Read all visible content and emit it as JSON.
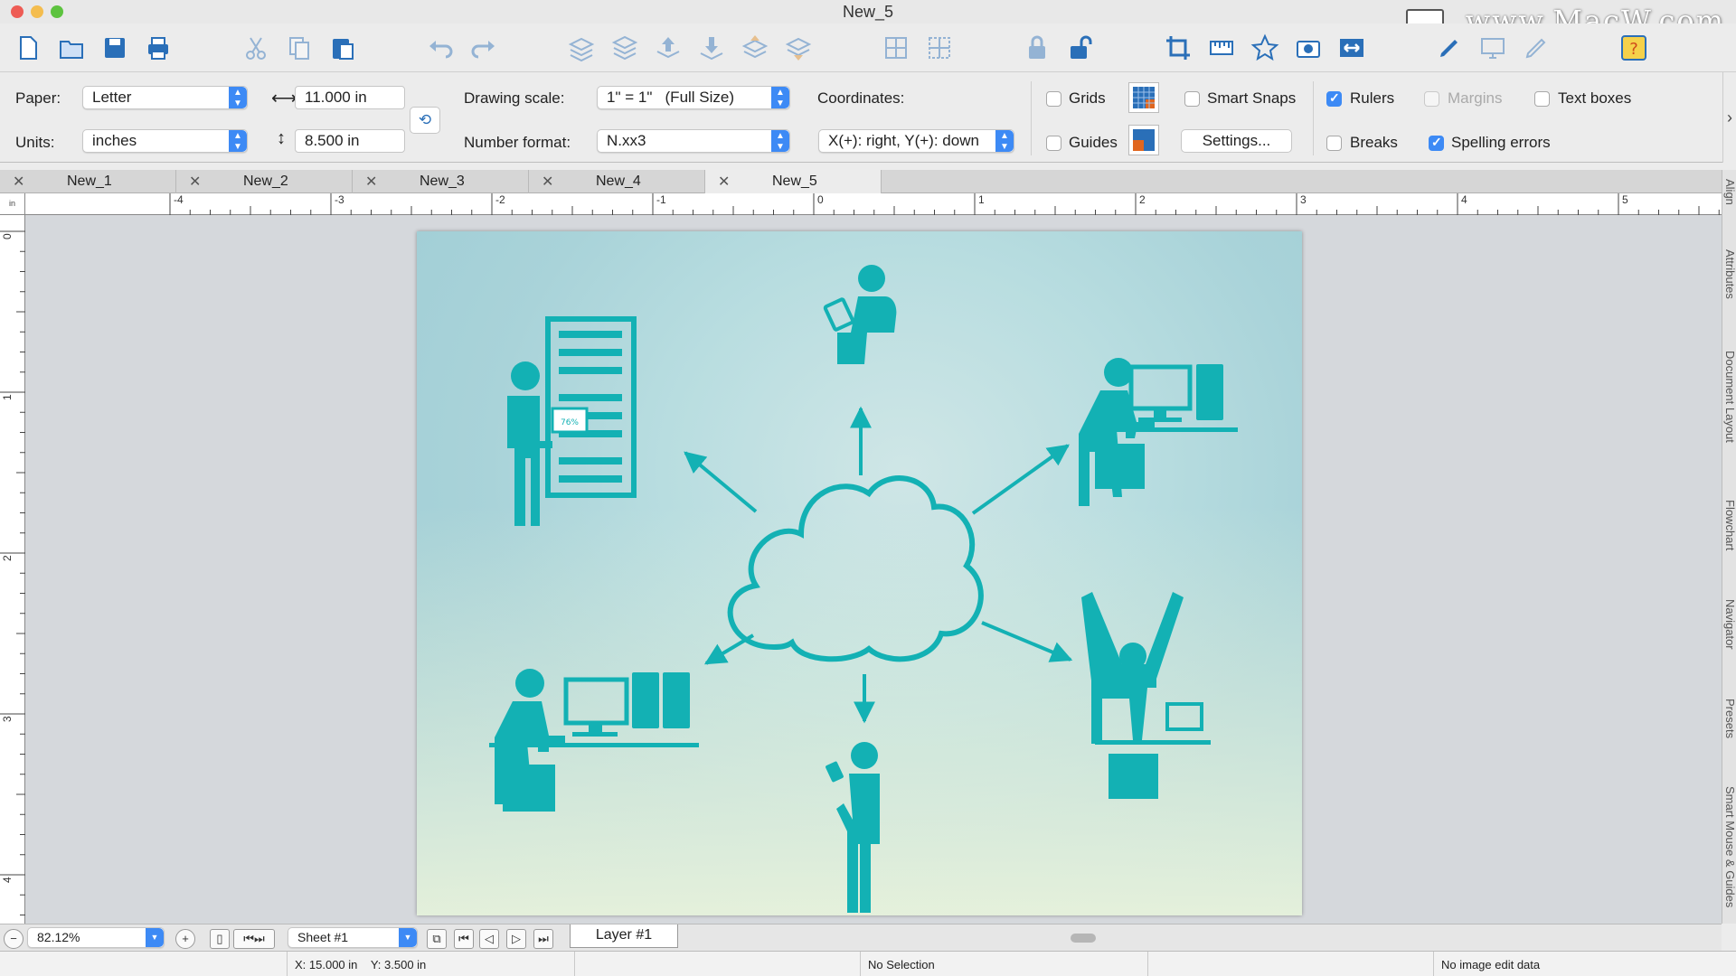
{
  "window": {
    "title": "New_5",
    "watermark": "www.MacW.com",
    "traffic_colors": [
      "#ee5c55",
      "#f4bd4f",
      "#5dc33f"
    ]
  },
  "toolbar": {
    "icons": [
      "new-document-icon",
      "open-document-icon",
      "save-icon",
      "print-icon",
      "cut-icon",
      "copy-icon",
      "paste-icon",
      "undo-icon",
      "redo-icon",
      "layers-icon",
      "layers-stack-icon",
      "bring-forward-icon",
      "send-backward-icon",
      "bring-to-front-icon",
      "send-to-back-icon",
      "group-icon",
      "ungroup-icon",
      "lock-icon",
      "unlock-icon",
      "crop-icon",
      "ruler-icon",
      "star-shape-icon",
      "camera-icon",
      "fit-width-icon",
      "pen-icon",
      "monitor-icon",
      "pencil-icon",
      "help-icon"
    ]
  },
  "props": {
    "paper_label": "Paper:",
    "paper_value": "Letter",
    "units_label": "Units:",
    "units_value": "inches",
    "width_value": "11.000 in",
    "height_value": "8.500 in",
    "drawing_scale_label": "Drawing scale:",
    "drawing_scale_value": "1\" = 1\"   (Full Size)",
    "number_format_label": "Number format:",
    "number_format_value": "N.xx3",
    "coordinates_label": "Coordinates:",
    "coordinates_value": "X(+): right, Y(+): down",
    "grids_label": "Grids",
    "guides_label": "Guides",
    "smart_snaps_label": "Smart Snaps",
    "settings_label": "Settings...",
    "rulers_label": "Rulers",
    "breaks_label": "Breaks",
    "margins_label": "Margins",
    "spelling_label": "Spelling errors",
    "text_boxes_label": "Text boxes",
    "grids_checked": false,
    "guides_checked": false,
    "smart_snaps_checked": false,
    "rulers_checked": true,
    "breaks_checked": false,
    "margins_checked": false,
    "spelling_checked": true,
    "text_boxes_checked": false
  },
  "tabs": [
    {
      "label": "New_1",
      "active": false
    },
    {
      "label": "New_2",
      "active": false
    },
    {
      "label": "New_3",
      "active": false
    },
    {
      "label": "New_4",
      "active": false
    },
    {
      "label": "New_5",
      "active": true
    }
  ],
  "ruler": {
    "unit": "in",
    "h_labels": [
      "-4",
      "-3",
      "-2",
      "-1",
      "0",
      "1",
      "2",
      "3",
      "4",
      "5"
    ],
    "v_labels": [
      "0",
      "1",
      "2",
      "3",
      "4"
    ]
  },
  "drawing": {
    "accent": "#13b1b4",
    "badge_text": "76%"
  },
  "right_dock": [
    "Align",
    "Attributes",
    "Document Layout",
    "Flowchart",
    "Navigator",
    "Presets",
    "Smart Mouse & Guides"
  ],
  "bottom": {
    "zoom": "82.12%",
    "sheet": "Sheet #1",
    "layer": "Layer #1"
  },
  "status": {
    "x": "X: 15.000 in",
    "y": "Y: 3.500 in",
    "selection": "No Selection",
    "image": "No image edit data"
  }
}
